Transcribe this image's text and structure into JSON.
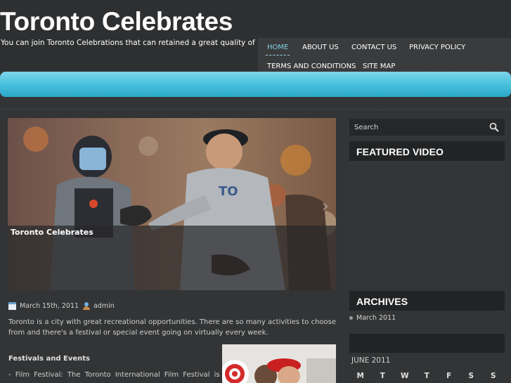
{
  "header": {
    "site_title": "Toronto Celebrates",
    "tagline": "You can join Toronto Celebrations that can retained a great quality of life."
  },
  "nav": {
    "items": [
      {
        "label": "HOME",
        "active": true
      },
      {
        "label": "ABOUT US",
        "active": false
      },
      {
        "label": "CONTACT US",
        "active": false
      },
      {
        "label": "PRIVACY POLICY",
        "active": false
      },
      {
        "label": "TERMS AND CONDITIONS",
        "active": false
      },
      {
        "label": "SITE MAP",
        "active": false
      }
    ]
  },
  "colors": {
    "accent_blue": "#4cc3de",
    "nav_active": "#7fd0e8",
    "page_bg": "#333435",
    "widget_head_bg": "#222324"
  },
  "post": {
    "feature_caption": "Toronto Celebrates",
    "date": "March 15th, 2011",
    "author": "admin",
    "date_icon": "calendar-icon",
    "author_icon": "user-icon",
    "intro": "Toronto is a city with great recreational opportunities. There are so many activities to choose from and there's a festival or special event going on virtually every week.",
    "section_heading": "Festivals and Events",
    "film_line": "- Film Festival: The Toronto International Film Festival is"
  },
  "sidebar": {
    "search": {
      "placeholder": "Search",
      "icon": "search-icon"
    },
    "featured_video_title": "FEATURED VIDEO",
    "archives_title": "ARCHIVES",
    "archives": [
      "March 2011"
    ],
    "calendar": {
      "caption": "JUNE 2011",
      "days": [
        "M",
        "T",
        "W",
        "T",
        "F",
        "S",
        "S"
      ]
    }
  }
}
